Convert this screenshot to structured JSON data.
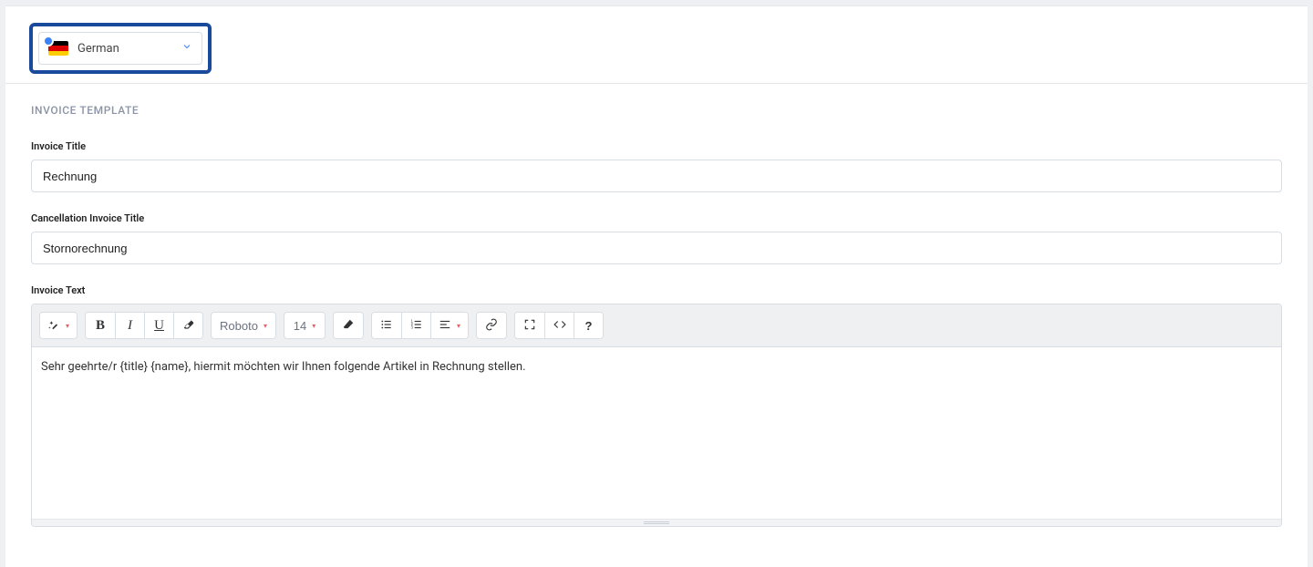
{
  "language": {
    "label": "German"
  },
  "section": {
    "title": "INVOICE TEMPLATE"
  },
  "fields": {
    "invoice_title": {
      "label": "Invoice Title",
      "value": "Rechnung"
    },
    "cancel_invoice_title": {
      "label": "Cancellation Invoice Title",
      "value": "Stornorechnung"
    },
    "invoice_text": {
      "label": "Invoice Text",
      "value": "Sehr geehrte/r {title} {name}, hiermit möchten wir Ihnen folgende Artikel in Rechnung stellen."
    }
  },
  "editor_toolbar": {
    "font_name": "Roboto",
    "font_size": "14"
  }
}
